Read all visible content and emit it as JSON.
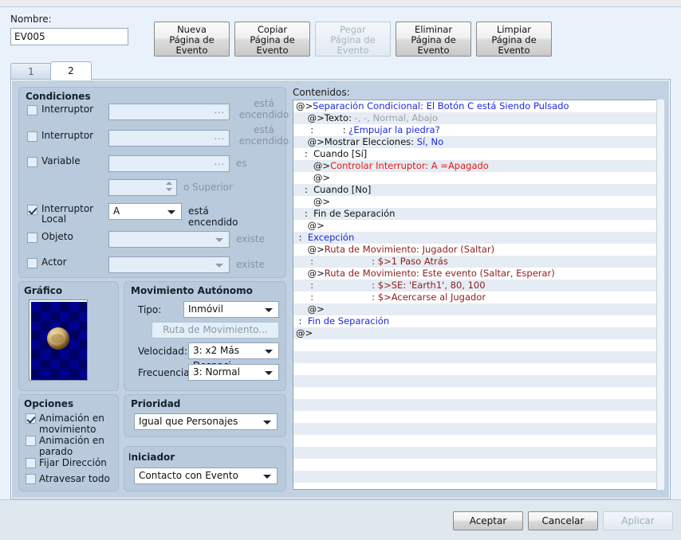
{
  "window": {
    "name_label": "Nombre:",
    "name_value": "EV005"
  },
  "page_buttons": [
    {
      "label": "Nueva\nPágina de\nEvento",
      "disabled": false
    },
    {
      "label": "Copiar\nPágina de\nEvento",
      "disabled": false
    },
    {
      "label": "Pegar\nPágina de\nEvento",
      "disabled": true
    },
    {
      "label": "Eliminar\nPágina de\nEvento",
      "disabled": false
    },
    {
      "label": "Limpiar\nPágina de\nEvento",
      "disabled": false
    }
  ],
  "tabs": [
    {
      "label": "1",
      "active": false
    },
    {
      "label": "2",
      "active": true
    }
  ],
  "conditions": {
    "title": "Condiciones",
    "rows": [
      {
        "label": "Interruptor",
        "checked": false,
        "value": "",
        "suffix": "está\nencendido",
        "suffix_dim": true,
        "control": "textbrowse"
      },
      {
        "label": "Interruptor",
        "checked": false,
        "value": "",
        "suffix": "está\nencendido",
        "suffix_dim": true,
        "control": "textbrowse"
      },
      {
        "label": "Variable",
        "checked": false,
        "value": "",
        "suffix": "es",
        "suffix_dim": true,
        "control": "textbrowse"
      },
      {
        "label": "",
        "checked": null,
        "value": "",
        "suffix": "o Superior",
        "suffix_dim": true,
        "control": "spinner"
      },
      {
        "label": "Interruptor\nLocal",
        "checked": true,
        "value": "A",
        "suffix": "está encendido",
        "suffix_dim": false,
        "control": "combo"
      },
      {
        "label": "Objeto",
        "checked": false,
        "value": "",
        "suffix": "existe",
        "suffix_dim": true,
        "control": "combo-disabled"
      },
      {
        "label": "Actor",
        "checked": false,
        "value": "",
        "suffix": "existe",
        "suffix_dim": true,
        "control": "combo-disabled"
      }
    ]
  },
  "graphic": {
    "title": "Gráfico",
    "sprite_name": "boulder-sprite"
  },
  "movement": {
    "title": "Movimiento Autónomo",
    "type_label": "Tipo:",
    "type_value": "Inmóvil",
    "route_button": "Ruta de Movimiento...",
    "speed_label": "Velocidad:",
    "speed_value": "3: x2 Más Despaci",
    "freq_label": "Frecuencia:",
    "freq_value": "3: Normal"
  },
  "options": {
    "title": "Opciones",
    "items": [
      {
        "label": "Animación en\nmovimiento",
        "checked": true
      },
      {
        "label": "Animación en\nparado",
        "checked": false
      },
      {
        "label": "Fijar Dirección",
        "checked": false
      },
      {
        "label": "Atravesar todo",
        "checked": false
      }
    ]
  },
  "priority": {
    "title": "Prioridad",
    "value": "Igual que Personajes"
  },
  "trigger": {
    "title": "Iniciador",
    "value": "Contacto con Evento"
  },
  "contents": {
    "label": "Contenidos:",
    "rows": [
      {
        "segs": [
          {
            "t": "@>",
            "c": "c-dark"
          },
          {
            "t": "Separación Condicional: El Botón C está Siendo Pulsado",
            "c": "c-blue"
          }
        ]
      },
      {
        "segs": [
          {
            "t": "    @>",
            "c": "c-dark"
          },
          {
            "t": "Texto",
            "c": "c-dark"
          },
          {
            "t": ": ",
            "c": "c-dark"
          },
          {
            "t": "-, -, Normal, Abajo",
            "c": "c-gray"
          }
        ]
      },
      {
        "segs": [
          {
            "t": "     :          : ",
            "c": "c-dark"
          },
          {
            "t": "¿Empujar la piedra?",
            "c": "c-blue"
          }
        ]
      },
      {
        "segs": [
          {
            "t": "    @>",
            "c": "c-dark"
          },
          {
            "t": "Mostrar Elecciones: ",
            "c": "c-dark"
          },
          {
            "t": "Sí, No",
            "c": "c-blue"
          }
        ]
      },
      {
        "segs": [
          {
            "t": "   :  Cuando [Sí]",
            "c": "c-dark"
          }
        ]
      },
      {
        "segs": [
          {
            "t": "      @>",
            "c": "c-dark"
          },
          {
            "t": "Controlar Interruptor: A =Apagado",
            "c": "c-red"
          }
        ]
      },
      {
        "segs": [
          {
            "t": "      @>",
            "c": "c-dark"
          }
        ]
      },
      {
        "segs": [
          {
            "t": "   :  Cuando [No]",
            "c": "c-dark"
          }
        ]
      },
      {
        "segs": [
          {
            "t": "      @>",
            "c": "c-dark"
          }
        ]
      },
      {
        "segs": [
          {
            "t": "   :  Fin de Separación",
            "c": "c-dark"
          }
        ]
      },
      {
        "segs": [
          {
            "t": "    @>",
            "c": "c-dark"
          }
        ]
      },
      {
        "segs": [
          {
            "t": " :  ",
            "c": "c-dark"
          },
          {
            "t": "Excepción",
            "c": "c-blue"
          }
        ]
      },
      {
        "segs": [
          {
            "t": "    @>",
            "c": "c-dark"
          },
          {
            "t": "Ruta de Movimiento: Jugador (Saltar)",
            "c": "c-maroon"
          }
        ]
      },
      {
        "segs": [
          {
            "t": "     :                    ",
            "c": "c-maroon"
          },
          {
            "t": ": $>1 Paso Atrás",
            "c": "c-maroon"
          }
        ]
      },
      {
        "segs": [
          {
            "t": "    @>",
            "c": "c-dark"
          },
          {
            "t": "Ruta de Movimiento: Este evento (Saltar, Esperar)",
            "c": "c-maroon"
          }
        ]
      },
      {
        "segs": [
          {
            "t": "     :                    ",
            "c": "c-maroon"
          },
          {
            "t": ": $>SE: 'Earth1', 80, 100",
            "c": "c-maroon"
          }
        ]
      },
      {
        "segs": [
          {
            "t": "     :                    ",
            "c": "c-maroon"
          },
          {
            "t": ": $>Acercarse al Jugador",
            "c": "c-maroon"
          }
        ]
      },
      {
        "segs": [
          {
            "t": "    @>",
            "c": "c-dark"
          }
        ]
      },
      {
        "segs": [
          {
            "t": " :  ",
            "c": "c-dark"
          },
          {
            "t": "Fin de Separación",
            "c": "c-blue"
          }
        ]
      },
      {
        "segs": [
          {
            "t": "@>",
            "c": "c-dark"
          }
        ]
      }
    ],
    "total_rows": 32
  },
  "footer": {
    "accept": "Aceptar",
    "cancel": "Cancelar",
    "apply": "Aplicar",
    "apply_disabled": true
  }
}
